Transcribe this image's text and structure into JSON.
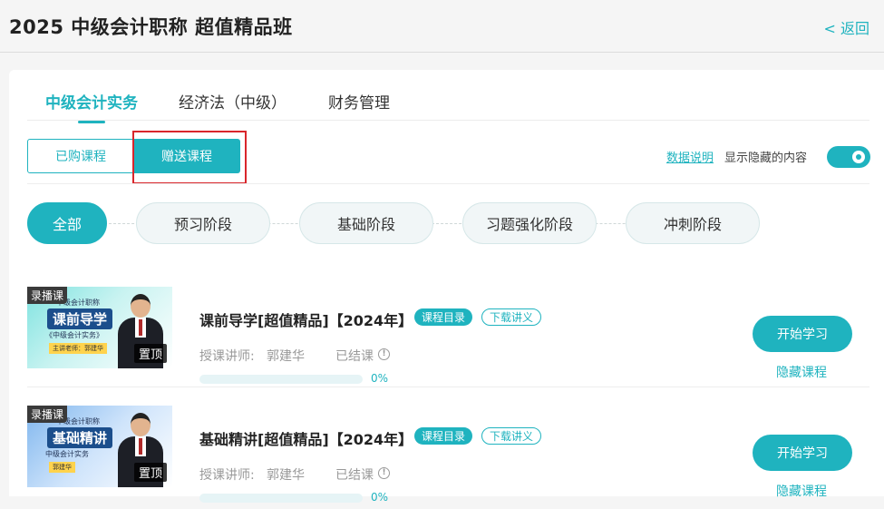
{
  "header": {
    "title": "2025 中级会计职称 超值精品班",
    "back_label": "< 返回"
  },
  "subject_tabs": [
    {
      "label": "中级会计实务",
      "active": true
    },
    {
      "label": "经济法（中级）",
      "active": false
    },
    {
      "label": "财务管理",
      "active": false
    }
  ],
  "course_type": {
    "purchased_label": "已购课程",
    "gift_label": "赠送课程"
  },
  "options": {
    "data_note_label": "数据说明",
    "show_hidden_label": "显示隐藏的内容",
    "show_hidden_on": true
  },
  "stages": [
    {
      "label": "全部",
      "active": true
    },
    {
      "label": "预习阶段",
      "active": false
    },
    {
      "label": "基础阶段",
      "active": false
    },
    {
      "label": "习题强化阶段",
      "active": false
    },
    {
      "label": "冲刺阶段",
      "active": false
    }
  ],
  "courses": [
    {
      "title": "课前导学[超值精品]【2024年】",
      "catalog_label": "课程目录",
      "download_label": "下载讲义",
      "teacher_label": "授课讲师:",
      "teacher_name": "郭建华",
      "status": "已结课",
      "progress_text": "0%",
      "progress": 0,
      "start_label": "开始学习",
      "hide_label": "隐藏课程",
      "thumb": {
        "badge": "录播课",
        "pin": "置顶",
        "subtitle": "中级会计职称",
        "main": "课前导学",
        "book": "《中级会计实务》",
        "teacher": "主讲老师：郭建华"
      }
    },
    {
      "title": "基础精讲[超值精品]【2024年】",
      "catalog_label": "课程目录",
      "download_label": "下载讲义",
      "teacher_label": "授课讲师:",
      "teacher_name": "郭建华",
      "status": "已结课",
      "progress_text": "0%",
      "progress": 0,
      "start_label": "开始学习",
      "hide_label": "隐藏课程",
      "thumb": {
        "badge": "录播课",
        "pin": "置顶",
        "subtitle": "中级会计职称",
        "main": "基础精讲",
        "book": "中级会计实务",
        "teacher": "郭建华"
      }
    }
  ],
  "colors": {
    "accent": "#1fb3bf",
    "highlight_box": "#d9262c"
  }
}
